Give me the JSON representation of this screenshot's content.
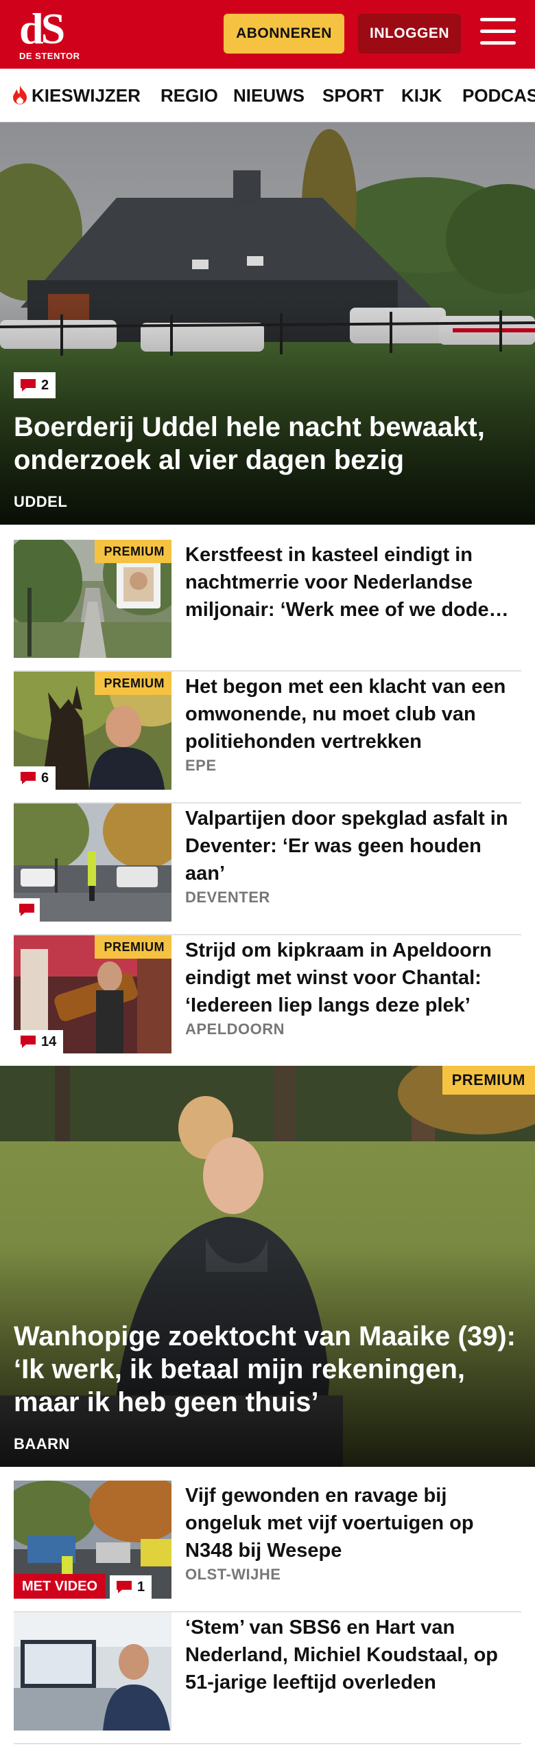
{
  "header": {
    "logo_mark": "dS",
    "logo_sub": "DE STENTOR",
    "subscribe_label": "ABONNEREN",
    "login_label": "INLOGGEN"
  },
  "nav": {
    "items": [
      {
        "label": "KIESWIJZER"
      },
      {
        "label": "REGIO"
      },
      {
        "label": "NIEUWS"
      },
      {
        "label": "SPORT"
      },
      {
        "label": "KIJK"
      },
      {
        "label": "PODCAST"
      }
    ]
  },
  "hero": {
    "comment_count": "2",
    "title": "Boerderij Uddel hele nacht bewaakt, onderzoek al vier dagen bezig",
    "location": "UDDEL"
  },
  "articles": [
    {
      "title": "Kerstfeest in kasteel eindigt in nachtmerrie voor Nederlandse miljonair: ‘Werk mee of we dode…",
      "premium": "PREMIUM",
      "location": ""
    },
    {
      "title": "Het begon met een klacht van een omwonende, nu moet club van politiehonden vertrekken",
      "premium": "PREMIUM",
      "comment_count": "6",
      "location": "EPE"
    },
    {
      "title": "Valpartijen door spekglad asfalt in Deventer: ‘Er was geen houden aan’",
      "comment_count": "",
      "location": "DEVENTER"
    },
    {
      "title": "Strijd om kipkraam in Apeldoorn eindigt met winst voor Chantal: ‘Iedereen liep langs deze plek’",
      "premium": "PREMIUM",
      "comment_count": "14",
      "location": "APELDOORN"
    }
  ],
  "feature": {
    "premium": "PREMIUM",
    "title": "Wanhopige zoektocht van Maaike (39): ‘Ik werk, ik betaal mijn rekeningen, maar ik heb geen thuis’",
    "location": "BAARN"
  },
  "articles2": [
    {
      "title": "Vijf gewonden en ravage bij ongeluk met vijf voertuigen op N348 bij Wesepe",
      "video_label": "MET VIDEO",
      "comment_count": "1",
      "location": "OLST-WIJHE"
    },
    {
      "title": "‘Stem’ van SBS6 en Hart van Nederland, Michiel Koudstaal, op 51-jarige leeftijd overleden",
      "location": ""
    }
  ],
  "colors": {
    "brand_red": "#d0021b",
    "premium_yellow": "#f5c242",
    "login_dark_red": "#9c0a14"
  }
}
